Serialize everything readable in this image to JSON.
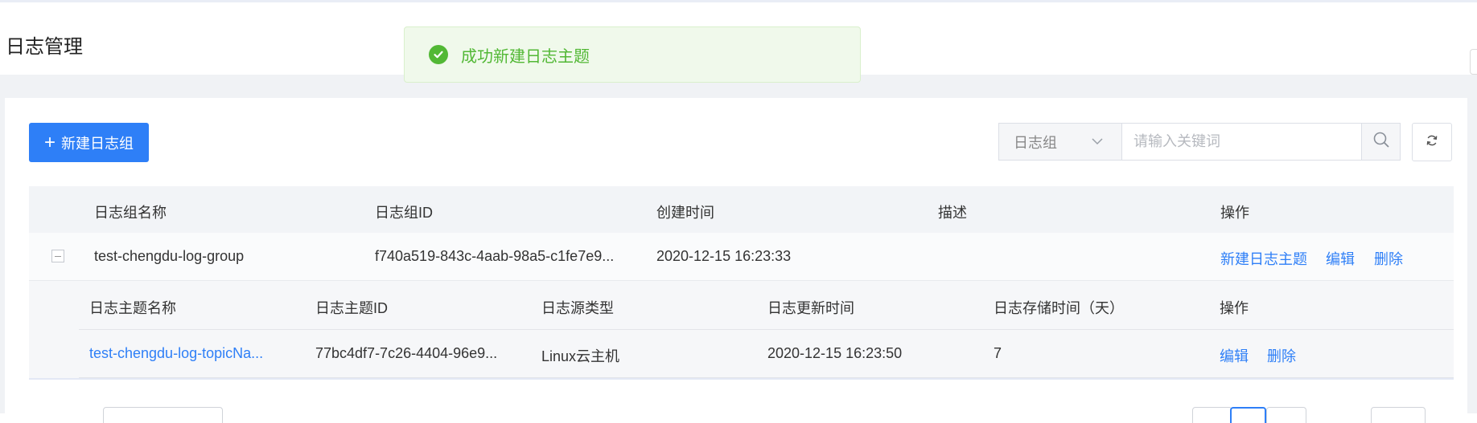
{
  "page": {
    "title": "日志管理"
  },
  "toast": {
    "message": "成功新建日志主题",
    "color": "#52b835"
  },
  "toolbar": {
    "new_group_icon": "+",
    "new_group_label": "新建日志组",
    "filter_select_value": "日志组",
    "search_placeholder": "请输入关键词",
    "accent": "#2e7ff7",
    "icons": [
      "plus-icon",
      "chevron-down-icon",
      "search-icon",
      "refresh-icon"
    ]
  },
  "table": {
    "columns": [
      "日志组名称",
      "日志组ID",
      "创建时间",
      "描述",
      "操作"
    ],
    "rows": [
      {
        "name": "test-chengdu-log-group",
        "id": "f740a519-843c-4aab-98a5-c1fe7e9...",
        "created": "2020-12-15 16:23:33",
        "desc": "",
        "actions": [
          "新建日志主题",
          "编辑",
          "删除"
        ],
        "expanded": true,
        "topics": {
          "columns": [
            "日志主题名称",
            "日志主题ID",
            "日志源类型",
            "日志更新时间",
            "日志存储时间（天）",
            "操作"
          ],
          "rows": [
            {
              "name": "test-chengdu-log-topicNa...",
              "id": "77bc4df7-7c26-4404-96e9...",
              "source_type": "Linux云主机",
              "updated": "2020-12-15 16:23:50",
              "retention": "7",
              "actions": [
                "编辑",
                "删除"
              ]
            }
          ]
        }
      }
    ]
  }
}
